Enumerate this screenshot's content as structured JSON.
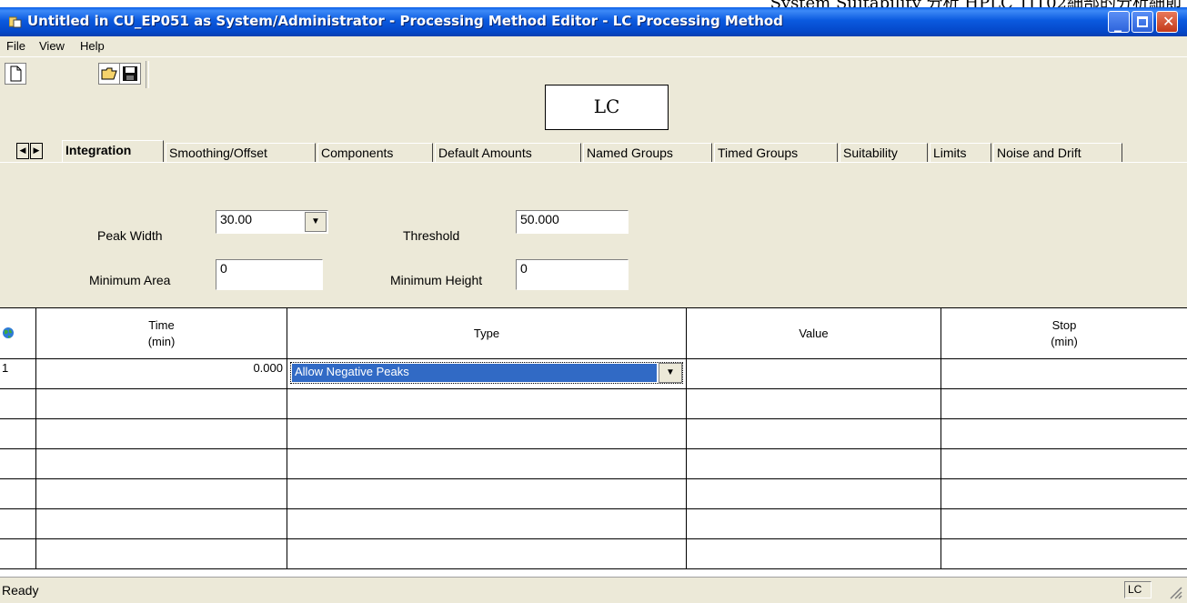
{
  "background_doc_text": "System Suitability 分析 HPLC 1IT02細部的分析細節",
  "window": {
    "title": "Untitled in CU_EP051 as System/Administrator - Processing Method Editor - LC Processing Method"
  },
  "menu": [
    "File",
    "View",
    "Help"
  ],
  "toolbar": {
    "new_icon": "new-document-icon",
    "open_icon": "open-folder-icon",
    "save_icon": "save-disk-icon"
  },
  "overlay_label": "LC",
  "tabs": [
    "Integration",
    "Smoothing/Offset",
    "Components",
    "Default Amounts",
    "Named Groups",
    "Timed Groups",
    "Suitability",
    "Limits",
    "Noise and Drift"
  ],
  "active_tab": "Integration",
  "fields": {
    "peak_width_label": "Peak Width",
    "peak_width_value": "30.00",
    "threshold_label": "Threshold",
    "threshold_value": "50.000",
    "min_area_label": "Minimum Area",
    "min_area_value": "0",
    "min_height_label": "Minimum Height",
    "min_height_value": "0"
  },
  "grid": {
    "corner_icon": "globe-icon",
    "headers": {
      "time": [
        "Time",
        "(min)"
      ],
      "type": "Type",
      "value": "Value",
      "stop": [
        "Stop",
        "(min)"
      ]
    },
    "rows": [
      {
        "num": "1",
        "time": "0.000",
        "type": "Allow Negative Peaks",
        "value": "",
        "stop": ""
      },
      {
        "num": "",
        "time": "",
        "type": "",
        "value": "",
        "stop": ""
      },
      {
        "num": "",
        "time": "",
        "type": "",
        "value": "",
        "stop": ""
      },
      {
        "num": "",
        "time": "",
        "type": "",
        "value": "",
        "stop": ""
      },
      {
        "num": "",
        "time": "",
        "type": "",
        "value": "",
        "stop": ""
      },
      {
        "num": "",
        "time": "",
        "type": "",
        "value": "",
        "stop": ""
      },
      {
        "num": "",
        "time": "",
        "type": "",
        "value": "",
        "stop": ""
      }
    ]
  },
  "status": {
    "text": "Ready",
    "panel": "LC"
  },
  "colors": {
    "titlebar": "#0A5FE8",
    "face": "#ECE9D8",
    "selection": "#316AC5"
  }
}
